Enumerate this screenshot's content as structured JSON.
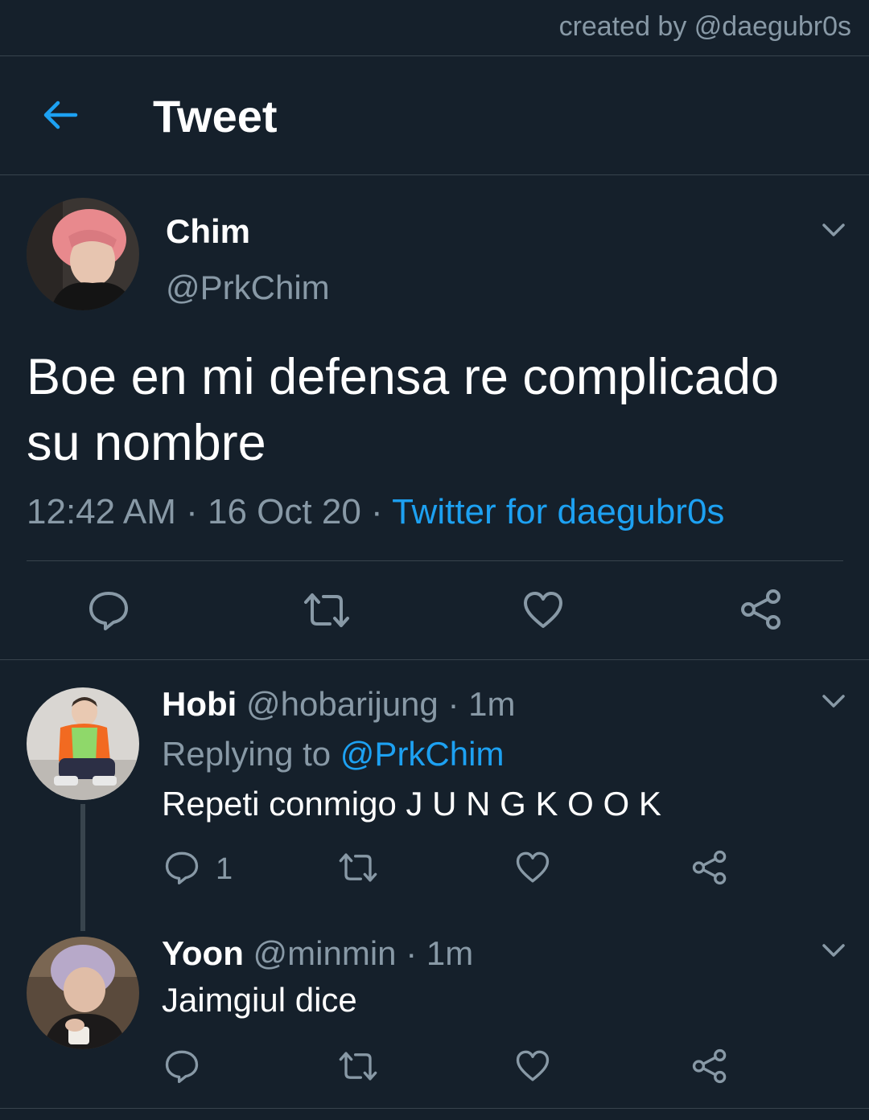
{
  "credit": "created by @daegubr0s",
  "header": {
    "title": "Tweet",
    "back_icon": "arrow-left-icon"
  },
  "main_tweet": {
    "name": "Chim",
    "handle": "@PrkChim",
    "text": "Boe en mi defensa re complicado su nombre",
    "time": "12:42 AM",
    "sep1": " · ",
    "date": "16 Oct 20",
    "sep2": " · ",
    "source": "Twitter for daegubr0s"
  },
  "replies": [
    {
      "name": "Hobi",
      "handle": "@hobarijung",
      "sep": " · ",
      "time": "1m",
      "replying_prefix": "Replying to ",
      "replying_to": "@PrkChim",
      "text": "Repeti conmigo  J U N G K O O K",
      "reply_count": "1"
    },
    {
      "name": "Yoon",
      "handle": "@minmin",
      "sep": " · ",
      "time": "1m",
      "text": "Jaimgiul dice"
    }
  ],
  "colors": {
    "background": "#15202b",
    "accent": "#1da1f2",
    "muted": "#8899a6",
    "divider": "#38444d"
  }
}
